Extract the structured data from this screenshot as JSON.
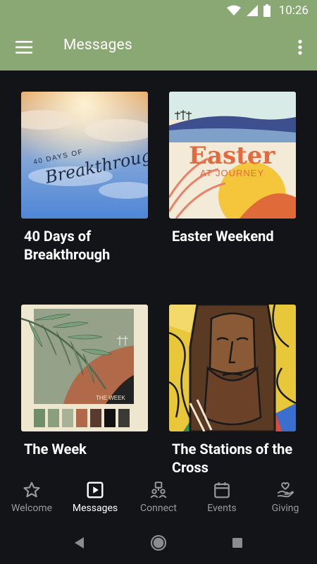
{
  "status_bar": {
    "time": "10:26"
  },
  "app_bar": {
    "title": "Messages"
  },
  "cards": [
    {
      "title": "40 Days of Breakthrough",
      "art_line1": "40 DAYS OF",
      "art_line2": "Breakthrough"
    },
    {
      "title": "Easter Weekend",
      "art_line1": "Easter",
      "art_line2": "AT JOURNEY"
    },
    {
      "title": "The Week",
      "art_line1": "THE WEEK"
    },
    {
      "title": "The Stations of the Cross"
    }
  ],
  "bottom_nav": {
    "items": [
      {
        "label": "Welcome",
        "icon": "star-icon"
      },
      {
        "label": "Messages",
        "icon": "play-box-icon"
      },
      {
        "label": "Connect",
        "icon": "people-icon"
      },
      {
        "label": "Events",
        "icon": "calendar-icon"
      },
      {
        "label": "Giving",
        "icon": "hand-heart-icon"
      }
    ],
    "active": "Messages"
  },
  "colors": {
    "accent": "#8aa873",
    "background": "#131417",
    "nav_inactive": "#9a9a9e"
  }
}
